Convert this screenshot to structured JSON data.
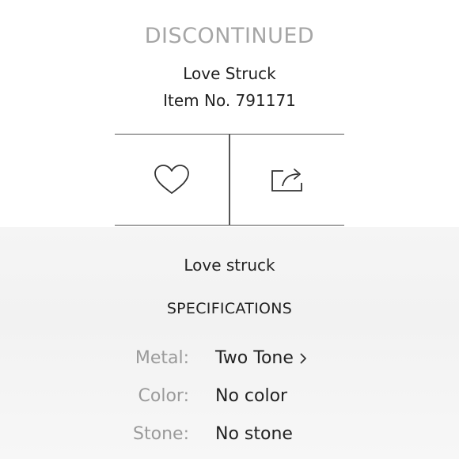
{
  "status": "DISCONTINUED",
  "product": {
    "name": "Love Struck",
    "item_number": "Item No. 791171"
  },
  "actions": {
    "favorite_icon": "heart-icon",
    "share_icon": "share-icon"
  },
  "description": "Love struck",
  "specifications": {
    "heading": "SPECIFICATIONS",
    "rows": [
      {
        "label": "Metal:",
        "value": "Two Tone"
      },
      {
        "label": "Color:",
        "value": "No color"
      },
      {
        "label": "Stone:",
        "value": "No stone"
      }
    ]
  },
  "colors": {
    "status_text": "#a6a6a6",
    "label_text": "#9a9a9a",
    "value_text": "#222222",
    "divider": "#555555"
  }
}
